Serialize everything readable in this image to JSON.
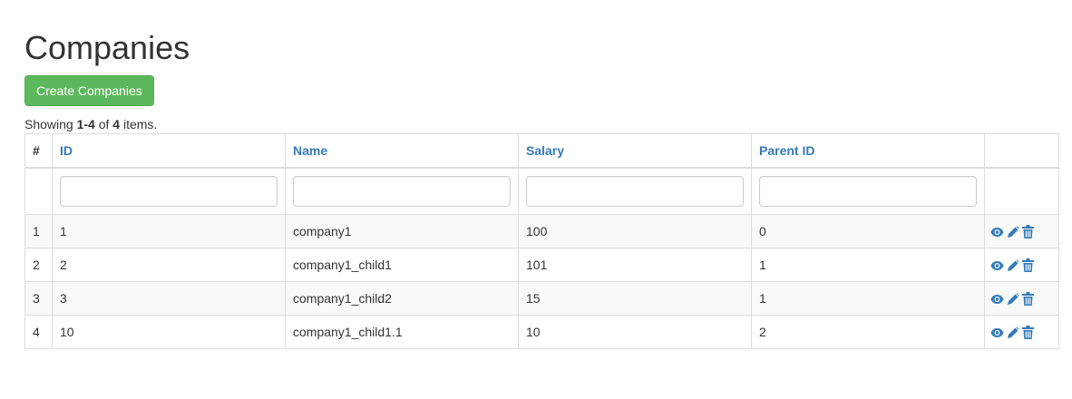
{
  "page": {
    "title": "Companies"
  },
  "toolbar": {
    "create_label": "Create Companies"
  },
  "summary": {
    "prefix": "Showing ",
    "range": "1-4",
    "middle": " of ",
    "total": "4",
    "suffix": " items."
  },
  "table": {
    "columns": {
      "index": "#",
      "id": "ID",
      "name": "Name",
      "salary": "Salary",
      "parent_id": "Parent ID"
    },
    "filters": {
      "id": "",
      "name": "",
      "salary": "",
      "parent_id": ""
    },
    "rows": [
      {
        "index": "1",
        "id": "1",
        "name": "company1",
        "salary": "100",
        "parent_id": "0"
      },
      {
        "index": "2",
        "id": "2",
        "name": "company1_child1",
        "salary": "101",
        "parent_id": "1"
      },
      {
        "index": "3",
        "id": "3",
        "name": "company1_child2",
        "salary": "15",
        "parent_id": "1"
      },
      {
        "index": "4",
        "id": "10",
        "name": "company1_child1.1",
        "salary": "10",
        "parent_id": "2"
      }
    ],
    "action_icons": [
      "eye-icon",
      "pencil-icon",
      "trash-icon"
    ]
  },
  "colors": {
    "success": "#5cb85c",
    "link": "#337ab7",
    "stripe": "#f9f9f9",
    "border": "#dddddd"
  }
}
